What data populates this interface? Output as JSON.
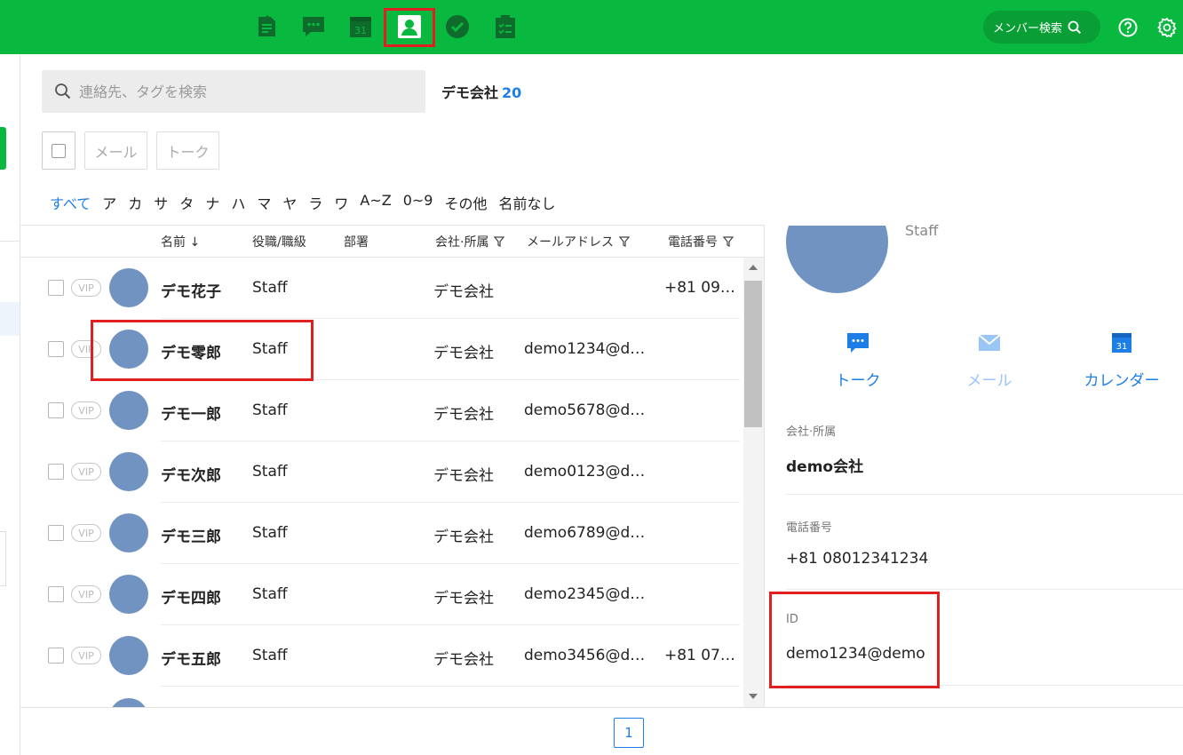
{
  "topbar": {
    "icons": [
      "notes-icon",
      "chat-icon",
      "calendar-icon",
      "contacts-icon",
      "task-check-icon",
      "clipboard-icon"
    ],
    "calendar_number": "31",
    "member_search_label": "メンバー検索",
    "active_icon": "contacts-icon",
    "colors": {
      "bar": "#09b83e",
      "highlight": "#e02020",
      "accent_blue": "#1e7ee8"
    }
  },
  "search": {
    "placeholder": "連絡先、タグを検索",
    "value": ""
  },
  "company": {
    "name": "デモ会社",
    "count": "20"
  },
  "toolbar": {
    "mail_label": "メール",
    "talk_label": "トーク"
  },
  "alpha_filter": [
    "すべて",
    "ア",
    "カ",
    "サ",
    "タ",
    "ナ",
    "ハ",
    "マ",
    "ヤ",
    "ラ",
    "ワ",
    "A~Z",
    "0~9",
    "その他",
    "名前なし"
  ],
  "table": {
    "headers": {
      "name": "名前 ↓",
      "role": "役職/職級",
      "dept": "部署",
      "company": "会社·所属",
      "mail": "メールアドレス",
      "tel": "電話番号"
    },
    "vip_label": "VIP",
    "rows": [
      {
        "name": "デモ花子",
        "role": "Staff",
        "company": "デモ会社",
        "mail": "",
        "tel": "+81 09…"
      },
      {
        "name": "デモ零郎",
        "role": "Staff",
        "company": "デモ会社",
        "mail": "demo1234@de…",
        "tel": ""
      },
      {
        "name": "デモ一郎",
        "role": "Staff",
        "company": "デモ会社",
        "mail": "demo5678@de…",
        "tel": ""
      },
      {
        "name": "デモ次郎",
        "role": "Staff",
        "company": "デモ会社",
        "mail": "demo0123@de…",
        "tel": ""
      },
      {
        "name": "デモ三郎",
        "role": "Staff",
        "company": "デモ会社",
        "mail": "demo6789@de…",
        "tel": ""
      },
      {
        "name": "デモ四郎",
        "role": "Staff",
        "company": "デモ会社",
        "mail": "demo2345@de…",
        "tel": ""
      },
      {
        "name": "デモ五郎",
        "role": "Staff",
        "company": "デモ会社",
        "mail": "demo3456@de…",
        "tel": "+81 07…"
      }
    ]
  },
  "pagination": {
    "current": "1"
  },
  "detail": {
    "title": "Staff",
    "actions": {
      "talk": "トーク",
      "mail": "メール",
      "calendar": "カレンダー"
    },
    "company_label": "会社·所属",
    "company_value": "demo会社",
    "tel_label": "電話番号",
    "tel_value": "+81 08012341234",
    "id_label": "ID",
    "id_value": "demo1234@demo"
  }
}
